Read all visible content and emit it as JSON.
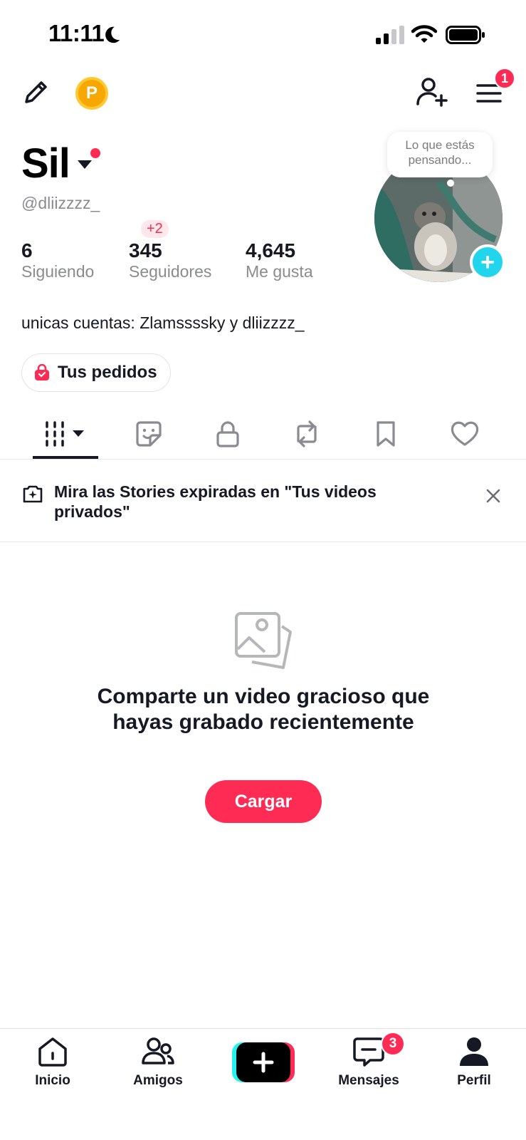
{
  "status_bar": {
    "time": "11:11"
  },
  "top_bar": {
    "coin_label": "P",
    "menu_badge": "1"
  },
  "profile": {
    "name": "Sil",
    "handle": "@dliizzzz_",
    "thought_bubble": "Lo que estás pensando...",
    "stats": [
      {
        "value": "6",
        "label": "Siguiendo"
      },
      {
        "value": "345",
        "label": "Seguidores",
        "delta": "+2"
      },
      {
        "value": "4,645",
        "label": "Me gusta"
      }
    ],
    "bio": "unicas cuentas: Zlamssssky y dliizzzz_",
    "orders_label": "Tus pedidos"
  },
  "tabs": [
    {
      "icon": "grid-icon",
      "active": true
    },
    {
      "icon": "sticker-icon",
      "active": false
    },
    {
      "icon": "lock-icon",
      "active": false
    },
    {
      "icon": "repost-icon",
      "active": false
    },
    {
      "icon": "bookmark-icon",
      "active": false
    },
    {
      "icon": "heart-icon",
      "active": false
    }
  ],
  "banner": {
    "text": "Mira las Stories expiradas en \"Tus videos privados\""
  },
  "empty_state": {
    "title": "Comparte un video gracioso que hayas grabado recientemente",
    "button_label": "Cargar"
  },
  "bottom_nav": {
    "items": [
      {
        "label": "Inicio",
        "icon": "home-icon"
      },
      {
        "label": "Amigos",
        "icon": "friends-icon"
      },
      {
        "label": "Mensajes",
        "icon": "messages-icon",
        "badge": "3"
      },
      {
        "label": "Perfil",
        "icon": "profile-icon"
      }
    ]
  },
  "colors": {
    "accent": "#fe2c55",
    "cyan": "#25f4ee",
    "text": "#161823",
    "secondary": "#8a8b91"
  }
}
